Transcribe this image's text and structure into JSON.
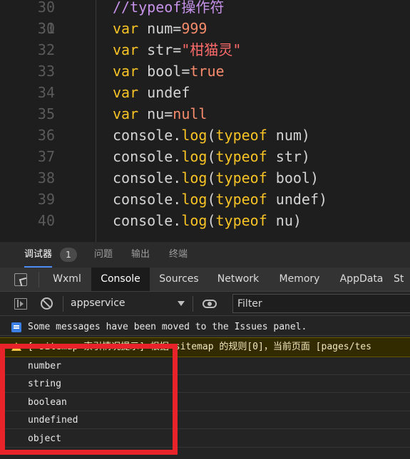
{
  "editor": {
    "partial_top_line": "30",
    "partial_bottom_line": "41",
    "lines": [
      {
        "n": "30",
        "tokens": [
          {
            "t": "//typeof操作符",
            "c": "cm"
          }
        ]
      },
      {
        "n": "31",
        "tokens": [
          {
            "t": "var",
            "c": "kw"
          },
          {
            "t": " num",
            "c": "id"
          },
          {
            "t": "=",
            "c": "op"
          },
          {
            "t": "999",
            "c": "num"
          }
        ]
      },
      {
        "n": "32",
        "tokens": [
          {
            "t": "var",
            "c": "kw"
          },
          {
            "t": " str",
            "c": "id"
          },
          {
            "t": "=",
            "c": "op"
          },
          {
            "t": "\"柑猫灵\"",
            "c": "str"
          }
        ]
      },
      {
        "n": "33",
        "tokens": [
          {
            "t": "var",
            "c": "kw"
          },
          {
            "t": " bool",
            "c": "id"
          },
          {
            "t": "=",
            "c": "op"
          },
          {
            "t": "true",
            "c": "num"
          }
        ]
      },
      {
        "n": "34",
        "tokens": [
          {
            "t": "var",
            "c": "kw"
          },
          {
            "t": " undef",
            "c": "id"
          }
        ]
      },
      {
        "n": "35",
        "tokens": [
          {
            "t": "var",
            "c": "kw"
          },
          {
            "t": " nu",
            "c": "id"
          },
          {
            "t": "=",
            "c": "op"
          },
          {
            "t": "null",
            "c": "num"
          }
        ]
      },
      {
        "n": "36",
        "tokens": [
          {
            "t": "console.",
            "c": "id"
          },
          {
            "t": "log",
            "c": "fn"
          },
          {
            "t": "(",
            "c": "op"
          },
          {
            "t": "typeof",
            "c": "kw"
          },
          {
            "t": " num)",
            "c": "id"
          }
        ]
      },
      {
        "n": "37",
        "tokens": [
          {
            "t": "console.",
            "c": "id"
          },
          {
            "t": "log",
            "c": "fn"
          },
          {
            "t": "(",
            "c": "op"
          },
          {
            "t": "typeof",
            "c": "kw"
          },
          {
            "t": " str)",
            "c": "id"
          }
        ]
      },
      {
        "n": "38",
        "tokens": [
          {
            "t": "console.",
            "c": "id"
          },
          {
            "t": "log",
            "c": "fn"
          },
          {
            "t": "(",
            "c": "op"
          },
          {
            "t": "typeof",
            "c": "kw"
          },
          {
            "t": " bool)",
            "c": "id"
          }
        ]
      },
      {
        "n": "39",
        "tokens": [
          {
            "t": "console.",
            "c": "id"
          },
          {
            "t": "log",
            "c": "fn"
          },
          {
            "t": "(",
            "c": "op"
          },
          {
            "t": "typeof",
            "c": "kw"
          },
          {
            "t": " undef)",
            "c": "id"
          }
        ]
      },
      {
        "n": "40",
        "tokens": [
          {
            "t": "console.",
            "c": "id"
          },
          {
            "t": "log",
            "c": "fn"
          },
          {
            "t": "(",
            "c": "op"
          },
          {
            "t": "typeof",
            "c": "kw"
          },
          {
            "t": " nu)",
            "c": "id"
          }
        ]
      }
    ]
  },
  "panel_tabs": {
    "debugger": "调试器",
    "debugger_badge": "1",
    "issues": "问题",
    "output": "输出",
    "terminal": "终端"
  },
  "tool_tabs": [
    "Wxml",
    "Console",
    "Sources",
    "Network",
    "Memory",
    "AppData",
    "St"
  ],
  "active_tool_tab": "Console",
  "filter_bar": {
    "context": "appservice",
    "filter_placeholder": "Filter"
  },
  "messages": {
    "info": "Some messages have been moved to the Issues panel.",
    "warn": "[ sitemap 索引情况提示] 根据 sitemap 的规则[0]，当前页面 [pages/tes"
  },
  "logs": [
    "number",
    "string",
    "boolean",
    "undefined",
    "object"
  ],
  "colors": {
    "keyword": "#f7c325",
    "comment": "#c792ea",
    "literal": "#f78c6c",
    "string": "#ff6b6b",
    "highlight_box": "#e8232a",
    "active_tab_underline": "#4d8cf5"
  }
}
